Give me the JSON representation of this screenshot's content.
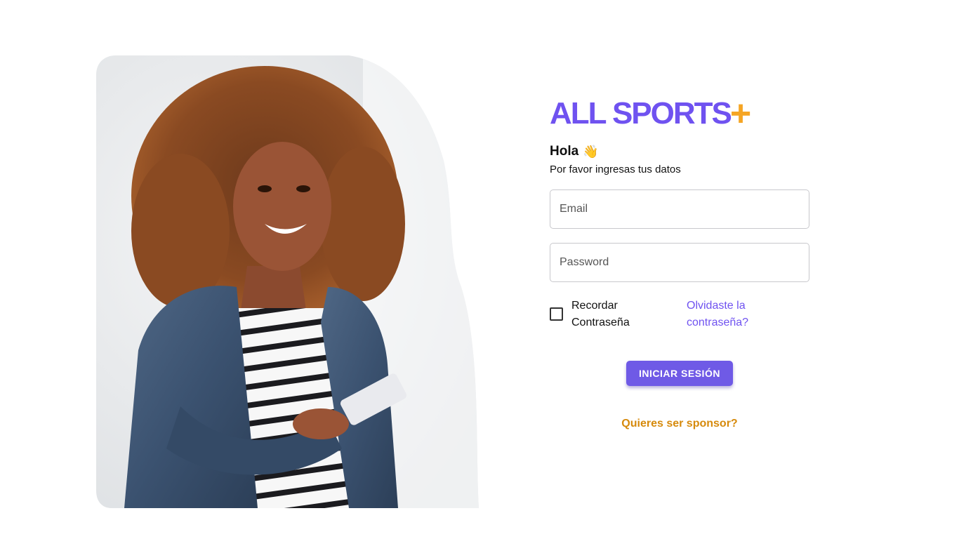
{
  "brand": {
    "name": "ALL SPORTS",
    "plus": "+",
    "primary_color": "#6f52f0",
    "accent_color": "#f5a524"
  },
  "hero": {
    "image": "smiling-woman-with-phone",
    "icon": "person-photo"
  },
  "login": {
    "greeting": "Hola",
    "greeting_icon": "👋",
    "subtitle": "Por favor ingresas tus datos",
    "email_placeholder": "Email",
    "password_placeholder": "Password",
    "remember_label": "Recordar Contraseña",
    "forgot_label": "Olvidaste la contraseña?",
    "submit_label": "INICIAR SESIÓN",
    "sponsor_label": "Quieres ser sponsor?",
    "sponsor_color": "#d68a0c"
  }
}
